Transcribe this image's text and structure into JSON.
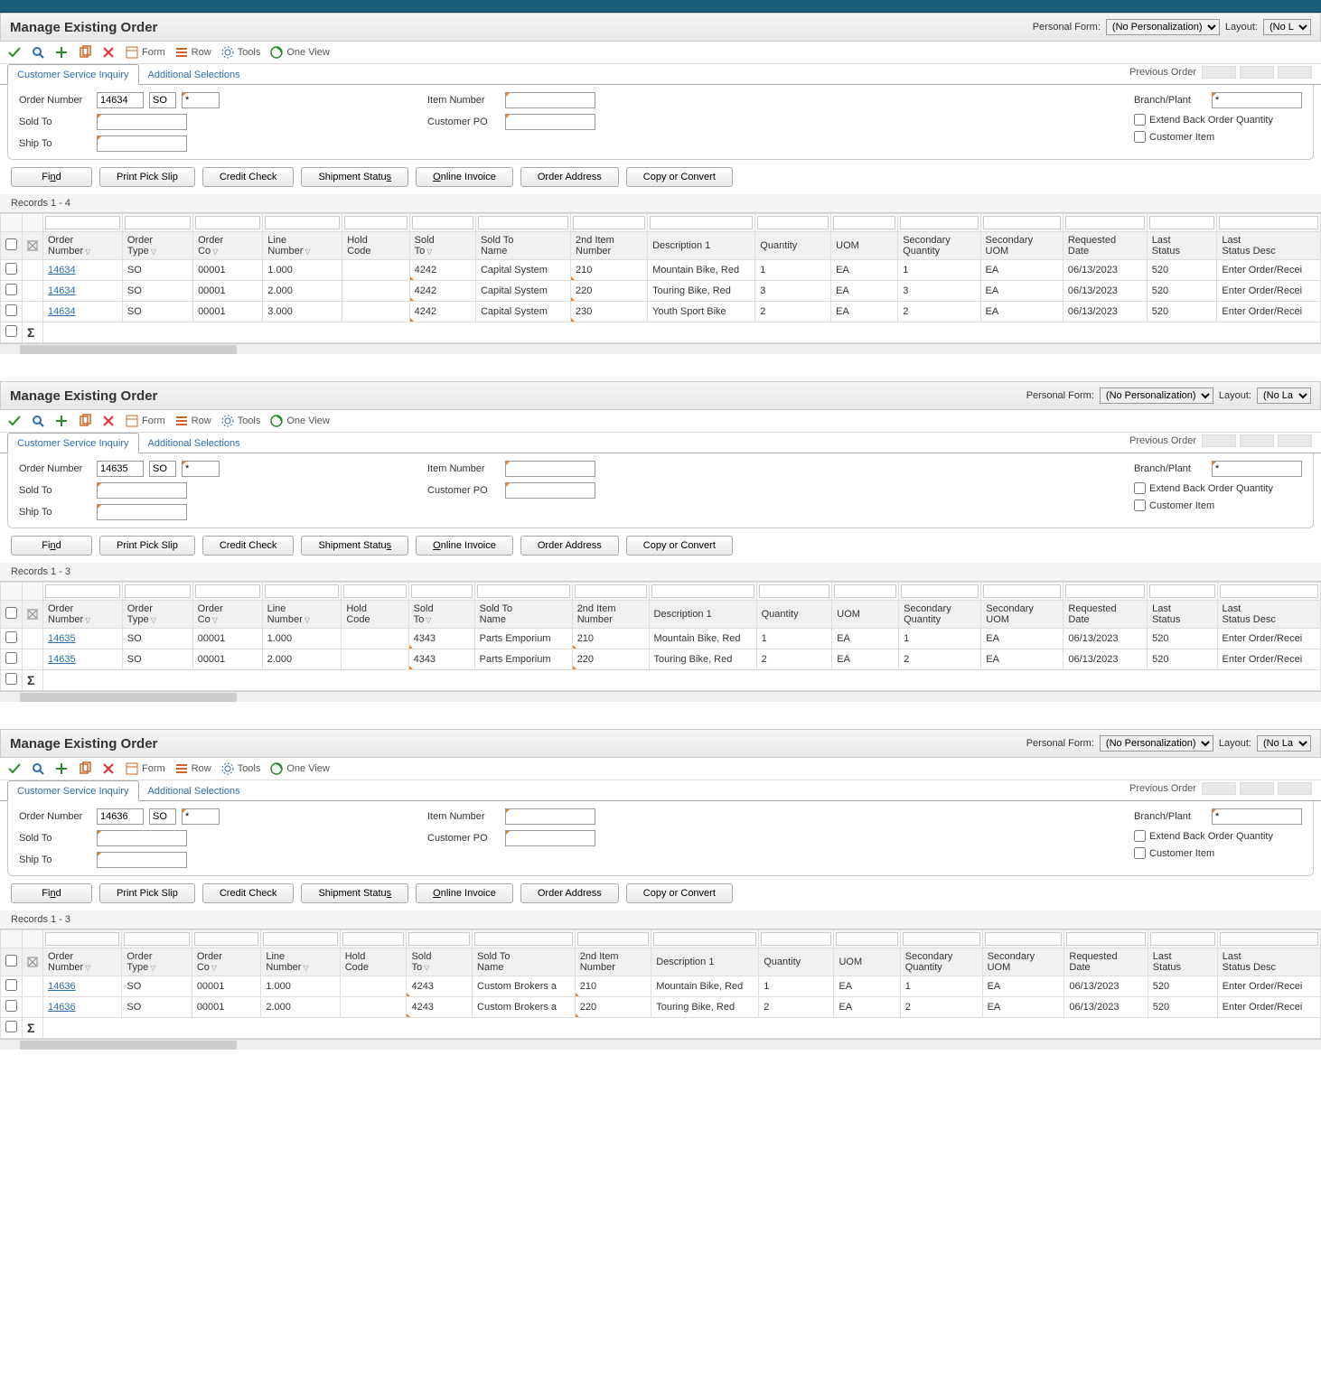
{
  "panels": [
    {
      "title": "Manage Existing Order",
      "personal_form_label": "Personal Form:",
      "personal_form_value": "(No Personalization)",
      "layout_label": "Layout:",
      "layout_value": "(No L",
      "toolbar": {
        "form": "Form",
        "row": "Row",
        "tools": "Tools",
        "oneview": "One View"
      },
      "tabs": {
        "active": "Customer Service Inquiry",
        "other": "Additional Selections"
      },
      "prev_order_label": "Previous Order",
      "form": {
        "order_number_label": "Order Number",
        "order_number": "14634",
        "order_type": "SO",
        "star": "*",
        "sold_to_label": "Sold To",
        "sold_to": "",
        "ship_to_label": "Ship To",
        "ship_to": "",
        "item_number_label": "Item Number",
        "item_number": "",
        "customer_po_label": "Customer PO",
        "customer_po": "",
        "branch_plant_label": "Branch/Plant",
        "branch_plant": "*",
        "extend_label": "Extend Back Order Quantity",
        "customer_item_label": "Customer Item"
      },
      "buttons": {
        "find_pre": "Fi",
        "find_u": "n",
        "find_post": "d",
        "print": "Print Pick Slip",
        "credit": "Credit Check",
        "shipment": "Shipment Statu",
        "shipment_u": "s",
        "online_pre": "",
        "online_u": "O",
        "online_post": "nline Invoice",
        "addr": "Order Address",
        "copy": "Copy or Convert"
      },
      "records": "Records 1 - 4",
      "columns": [
        "",
        "",
        "Order\nNumber",
        "Order\nType",
        "Order\nCo",
        "Line\nNumber",
        "Hold\nCode",
        "Sold\nTo",
        "Sold To\nName",
        "2nd Item\nNumber",
        "Description 1",
        "Quantity",
        "UOM",
        "Secondary\nQuantity",
        "Secondary\nUOM",
        "Requested\nDate",
        "Last\nStatus",
        "Last\nStatus Desc"
      ],
      "rows": [
        {
          "order": "14634",
          "type": "SO",
          "co": "00001",
          "line": "1.000",
          "hold": "",
          "soldto": "4242",
          "soldname": "Capital System",
          "item2": "210",
          "desc": "Mountain Bike, Red",
          "qty": "1",
          "uom": "EA",
          "sqty": "1",
          "suom": "EA",
          "reqdate": "06/13/2023",
          "lstatus": "520",
          "ldesc": "Enter Order/Recei"
        },
        {
          "order": "14634",
          "type": "SO",
          "co": "00001",
          "line": "2.000",
          "hold": "",
          "soldto": "4242",
          "soldname": "Capital System",
          "item2": "220",
          "desc": "Touring Bike, Red",
          "qty": "3",
          "uom": "EA",
          "sqty": "3",
          "suom": "EA",
          "reqdate": "06/13/2023",
          "lstatus": "520",
          "ldesc": "Enter Order/Recei"
        },
        {
          "order": "14634",
          "type": "SO",
          "co": "00001",
          "line": "3.000",
          "hold": "",
          "soldto": "4242",
          "soldname": "Capital System",
          "item2": "230",
          "desc": "Youth Sport Bike",
          "qty": "2",
          "uom": "EA",
          "sqty": "2",
          "suom": "EA",
          "reqdate": "06/13/2023",
          "lstatus": "520",
          "ldesc": "Enter Order/Recei"
        }
      ]
    },
    {
      "title": "Manage Existing Order",
      "personal_form_label": "Personal Form:",
      "personal_form_value": "(No Personalization)",
      "layout_label": "Layout:",
      "layout_value": "(No La",
      "toolbar": {
        "form": "Form",
        "row": "Row",
        "tools": "Tools",
        "oneview": "One View"
      },
      "tabs": {
        "active": "Customer Service Inquiry",
        "other": "Additional Selections"
      },
      "prev_order_label": "Previous Order",
      "form": {
        "order_number_label": "Order Number",
        "order_number": "14635",
        "order_type": "SO",
        "star": "*",
        "sold_to_label": "Sold To",
        "sold_to": "",
        "ship_to_label": "Ship To",
        "ship_to": "",
        "item_number_label": "Item Number",
        "item_number": "",
        "customer_po_label": "Customer PO",
        "customer_po": "",
        "branch_plant_label": "Branch/Plant",
        "branch_plant": "*",
        "extend_label": "Extend Back Order Quantity",
        "customer_item_label": "Customer Item"
      },
      "buttons": {
        "find_pre": "Fi",
        "find_u": "n",
        "find_post": "d",
        "print": "Print Pick Slip",
        "credit": "Credit Check",
        "shipment": "Shipment Statu",
        "shipment_u": "s",
        "online_pre": "",
        "online_u": "O",
        "online_post": "nline Invoice",
        "addr": "Order Address",
        "copy": "Copy or Convert"
      },
      "records": "Records 1 - 3",
      "columns": [
        "",
        "",
        "Order\nNumber",
        "Order\nType",
        "Order\nCo",
        "Line\nNumber",
        "Hold\nCode",
        "Sold\nTo",
        "Sold To\nName",
        "2nd Item\nNumber",
        "Description 1",
        "Quantity",
        "UOM",
        "Secondary\nQuantity",
        "Secondary\nUOM",
        "Requested\nDate",
        "Last\nStatus",
        "Last\nStatus Desc"
      ],
      "rows": [
        {
          "order": "14635",
          "type": "SO",
          "co": "00001",
          "line": "1.000",
          "hold": "",
          "soldto": "4343",
          "soldname": "Parts Emporium",
          "item2": "210",
          "desc": "Mountain Bike, Red",
          "qty": "1",
          "uom": "EA",
          "sqty": "1",
          "suom": "EA",
          "reqdate": "06/13/2023",
          "lstatus": "520",
          "ldesc": "Enter Order/Recei"
        },
        {
          "order": "14635",
          "type": "SO",
          "co": "00001",
          "line": "2.000",
          "hold": "",
          "soldto": "4343",
          "soldname": "Parts Emporium",
          "item2": "220",
          "desc": "Touring Bike, Red",
          "qty": "2",
          "uom": "EA",
          "sqty": "2",
          "suom": "EA",
          "reqdate": "06/13/2023",
          "lstatus": "520",
          "ldesc": "Enter Order/Recei"
        }
      ]
    },
    {
      "title": "Manage Existing Order",
      "personal_form_label": "Personal Form:",
      "personal_form_value": "(No Personalization)",
      "layout_label": "Layout:",
      "layout_value": "(No La",
      "toolbar": {
        "form": "Form",
        "row": "Row",
        "tools": "Tools",
        "oneview": "One View"
      },
      "tabs": {
        "active": "Customer Service Inquiry",
        "other": "Additional Selections"
      },
      "prev_order_label": "Previous Order",
      "form": {
        "order_number_label": "Order Number",
        "order_number": "14636",
        "order_type": "SO",
        "star": "*",
        "sold_to_label": "Sold To",
        "sold_to": "",
        "ship_to_label": "Ship To",
        "ship_to": "",
        "item_number_label": "Item Number",
        "item_number": "",
        "customer_po_label": "Customer PO",
        "customer_po": "",
        "branch_plant_label": "Branch/Plant",
        "branch_plant": "*",
        "extend_label": "Extend Back Order Quantity",
        "customer_item_label": "Customer Item"
      },
      "buttons": {
        "find_pre": "Fi",
        "find_u": "n",
        "find_post": "d",
        "print": "Print Pick Slip",
        "credit": "Credit Check",
        "shipment": "Shipment Statu",
        "shipment_u": "s",
        "online_pre": "",
        "online_u": "O",
        "online_post": "nline Invoice",
        "addr": "Order Address",
        "copy": "Copy or Convert"
      },
      "records": "Records 1 - 3",
      "columns": [
        "",
        "",
        "Order\nNumber",
        "Order\nType",
        "Order\nCo",
        "Line\nNumber",
        "Hold\nCode",
        "Sold\nTo",
        "Sold To\nName",
        "2nd Item\nNumber",
        "Description 1",
        "Quantity",
        "UOM",
        "Secondary\nQuantity",
        "Secondary\nUOM",
        "Requested\nDate",
        "Last\nStatus",
        "Last\nStatus Desc"
      ],
      "rows": [
        {
          "order": "14636",
          "type": "SO",
          "co": "00001",
          "line": "1.000",
          "hold": "",
          "soldto": "4243",
          "soldname": "Custom Brokers a",
          "item2": "210",
          "desc": "Mountain Bike, Red",
          "qty": "1",
          "uom": "EA",
          "sqty": "1",
          "suom": "EA",
          "reqdate": "06/13/2023",
          "lstatus": "520",
          "ldesc": "Enter Order/Recei"
        },
        {
          "order": "14636",
          "type": "SO",
          "co": "00001",
          "line": "2.000",
          "hold": "",
          "soldto": "4243",
          "soldname": "Custom Brokers a",
          "item2": "220",
          "desc": "Touring Bike, Red",
          "qty": "2",
          "uom": "EA",
          "sqty": "2",
          "suom": "EA",
          "reqdate": "06/13/2023",
          "lstatus": "520",
          "ldesc": "Enter Order/Recei"
        }
      ]
    }
  ]
}
